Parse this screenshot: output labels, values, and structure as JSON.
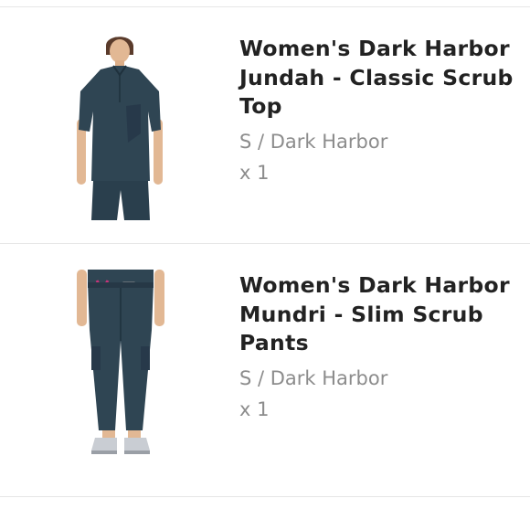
{
  "order_items": [
    {
      "name": "Women's Dark Harbor Jundah - Classic Scrub Top",
      "variant": "S / Dark Harbor",
      "quantity": "x 1",
      "image_icon": "scrub-top-product-image"
    },
    {
      "name": "Women's Dark Harbor Mundri - Slim Scrub Pants",
      "variant": "S / Dark Harbor",
      "quantity": "x 1",
      "image_icon": "scrub-pants-product-image"
    }
  ],
  "colors": {
    "garment": "#2f4553",
    "text_primary": "#222222",
    "text_secondary": "#8c8c8c",
    "divider": "#e6e6e6"
  }
}
